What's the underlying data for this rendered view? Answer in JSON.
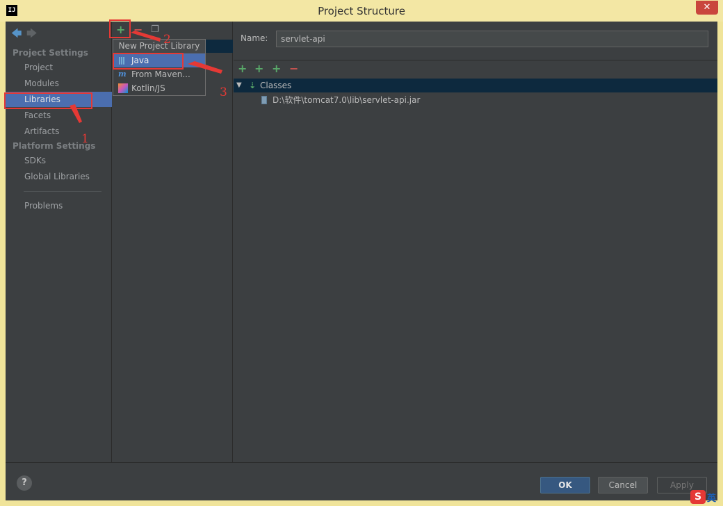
{
  "window": {
    "title": "Project Structure",
    "app_icon": "IJ",
    "close": "✕"
  },
  "nav": {
    "project_settings_header": "Project Settings",
    "platform_settings_header": "Platform Settings",
    "items": [
      "Project",
      "Modules",
      "Libraries",
      "Facets",
      "Artifacts"
    ],
    "platform_items": [
      "SDKs",
      "Global Libraries"
    ],
    "problems": "Problems",
    "selected": "Libraries"
  },
  "popup": {
    "header": "New Project Library",
    "items": [
      {
        "label": "Java",
        "icon": "java-library-icon"
      },
      {
        "label": "From Maven...",
        "icon": "maven-icon"
      },
      {
        "label": "Kotlin/JS",
        "icon": "kotlin-js-icon"
      }
    ]
  },
  "details": {
    "name_label": "Name:",
    "name_value": "servlet-api",
    "tree_root": "Classes",
    "tree_child": "D:\\软件\\tomcat7.0\\lib\\servlet-api.jar"
  },
  "buttons": {
    "ok": "OK",
    "cancel": "Cancel",
    "apply": "Apply",
    "help": "?"
  },
  "annotations": [
    "1",
    "2",
    "3"
  ],
  "tray": {
    "ime": "英",
    "logo": "S"
  },
  "colors": {
    "selection": "#4b6eaf",
    "annotation_red": "#e53935",
    "add_green": "#59a869",
    "remove_red": "#c75450"
  }
}
